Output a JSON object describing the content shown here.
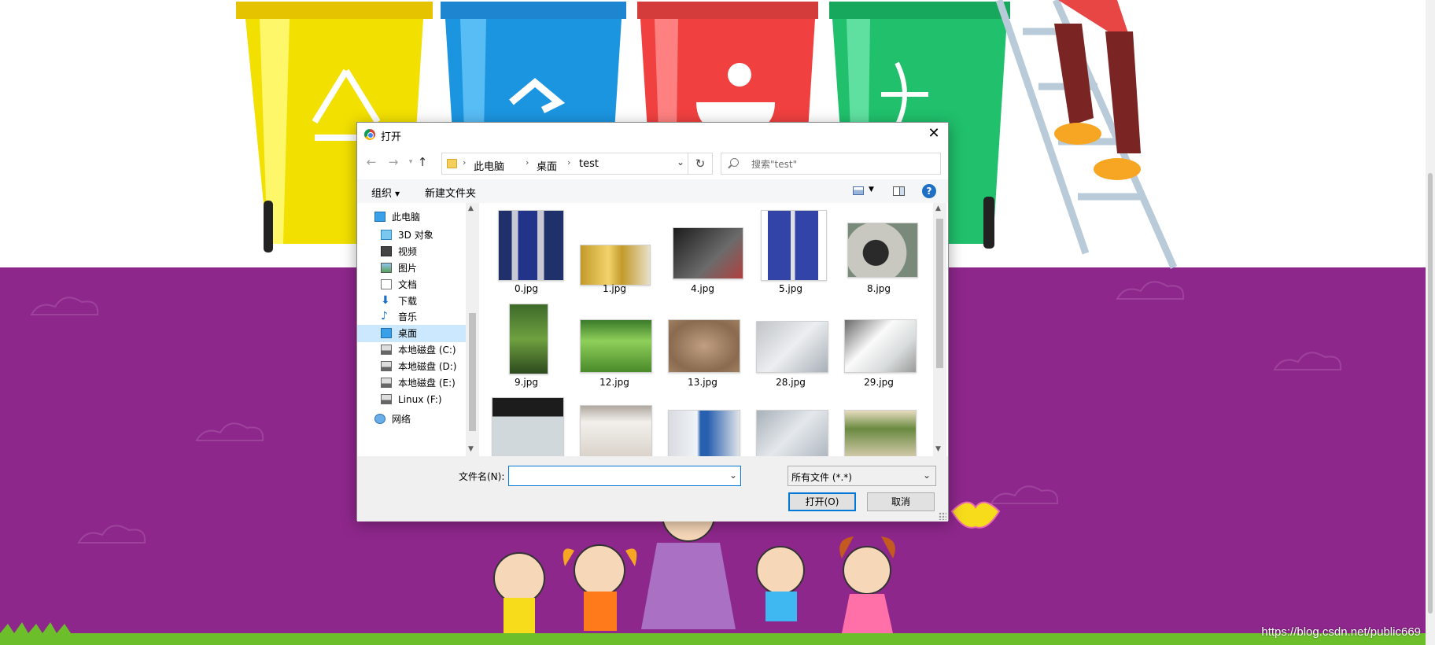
{
  "watermark": "https://blog.csdn.net/public669",
  "dialog": {
    "title": "打开",
    "address": {
      "crumbs": [
        "此电脑",
        "桌面",
        "test"
      ]
    },
    "search_placeholder": "搜索\"test\"",
    "toolbar": {
      "organize": "组织",
      "new_folder": "新建文件夹",
      "help": "?"
    },
    "nav_items": [
      {
        "label": "此电脑",
        "icon": "computer-icon"
      },
      {
        "label": "3D 对象",
        "icon": "cube-icon"
      },
      {
        "label": "视频",
        "icon": "video-icon"
      },
      {
        "label": "图片",
        "icon": "picture-icon"
      },
      {
        "label": "文档",
        "icon": "document-icon"
      },
      {
        "label": "下载",
        "icon": "download-icon"
      },
      {
        "label": "音乐",
        "icon": "music-icon"
      },
      {
        "label": "桌面",
        "icon": "desktop-icon",
        "selected": true
      },
      {
        "label": "本地磁盘 (C:)",
        "icon": "drive-c-icon"
      },
      {
        "label": "本地磁盘 (D:)",
        "icon": "drive-icon"
      },
      {
        "label": "本地磁盘 (E:)",
        "icon": "drive-icon"
      },
      {
        "label": "Linux (F:)",
        "icon": "drive-icon"
      },
      {
        "label": "网络",
        "icon": "network-icon"
      }
    ],
    "files": [
      {
        "name": "0.jpg"
      },
      {
        "name": "1.jpg"
      },
      {
        "name": "4.jpg"
      },
      {
        "name": "5.jpg"
      },
      {
        "name": "8.jpg"
      },
      {
        "name": "9.jpg"
      },
      {
        "name": "12.jpg"
      },
      {
        "name": "13.jpg"
      },
      {
        "name": "28.jpg"
      },
      {
        "name": "29.jpg"
      },
      {
        "name": ""
      },
      {
        "name": ""
      },
      {
        "name": ""
      },
      {
        "name": ""
      },
      {
        "name": ""
      }
    ],
    "filename_label": "文件名(N):",
    "filename_value": "",
    "filetype": "所有文件 (*.*)",
    "open_label": "打开(O)",
    "cancel_label": "取消"
  }
}
